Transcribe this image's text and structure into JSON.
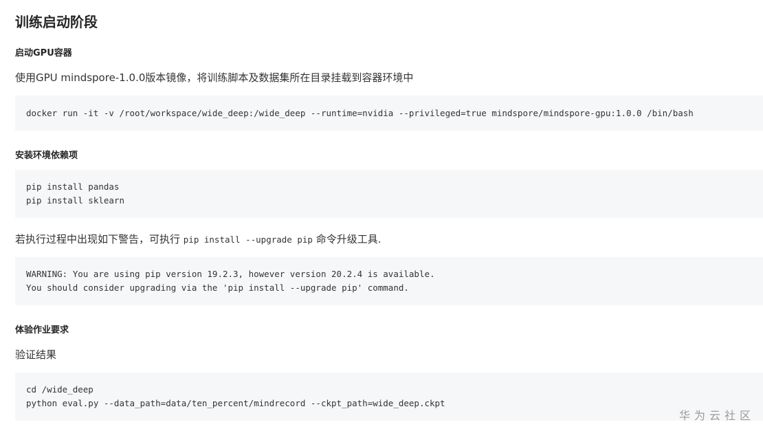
{
  "title": "训练启动阶段",
  "sections": {
    "start_gpu": {
      "heading": "启动GPU容器",
      "description": "使用GPU mindspore-1.0.0版本镜像，将训练脚本及数据集所在目录挂载到容器环境中",
      "code": [
        "docker run -it -v /root/workspace/wide_deep:/wide_deep --runtime=nvidia --privileged=true mindspore/mindspore-gpu:1.0.0 /bin/bash"
      ]
    },
    "install_deps": {
      "heading": "安装环境依赖项",
      "code": [
        "pip install pandas",
        "pip install sklearn"
      ],
      "note_prefix": "若执行过程中出现如下警告，可执行 ",
      "note_code": "pip install --upgrade pip",
      "note_suffix": " 命令升级工具.",
      "warning_code": [
        "WARNING: You are using pip version 19.2.3, however version 20.2.4 is available.",
        "You should consider upgrading via the 'pip install --upgrade pip' command."
      ]
    },
    "homework": {
      "heading": "体验作业要求",
      "subheading": "验证结果",
      "code": [
        "cd /wide_deep",
        "python eval.py --data_path=data/ten_percent/mindrecord --ckpt_path=wide_deep.ckpt"
      ]
    }
  },
  "watermark": "华为云社区"
}
